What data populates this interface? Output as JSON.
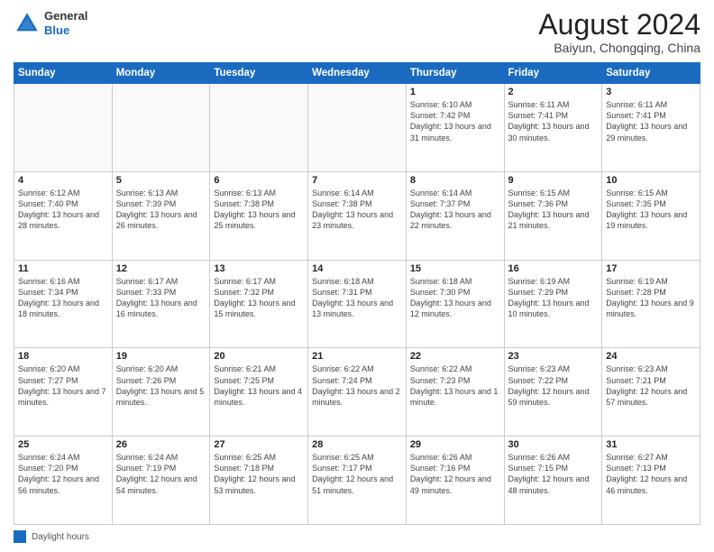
{
  "header": {
    "logo_line1": "General",
    "logo_line2": "Blue",
    "month_title": "August 2024",
    "location": "Baiyun, Chongqing, China"
  },
  "days_of_week": [
    "Sunday",
    "Monday",
    "Tuesday",
    "Wednesday",
    "Thursday",
    "Friday",
    "Saturday"
  ],
  "weeks": [
    [
      {
        "day": "",
        "info": ""
      },
      {
        "day": "",
        "info": ""
      },
      {
        "day": "",
        "info": ""
      },
      {
        "day": "",
        "info": ""
      },
      {
        "day": "1",
        "info": "Sunrise: 6:10 AM\nSunset: 7:42 PM\nDaylight: 13 hours and 31 minutes."
      },
      {
        "day": "2",
        "info": "Sunrise: 6:11 AM\nSunset: 7:41 PM\nDaylight: 13 hours and 30 minutes."
      },
      {
        "day": "3",
        "info": "Sunrise: 6:11 AM\nSunset: 7:41 PM\nDaylight: 13 hours and 29 minutes."
      }
    ],
    [
      {
        "day": "4",
        "info": "Sunrise: 6:12 AM\nSunset: 7:40 PM\nDaylight: 13 hours and 28 minutes."
      },
      {
        "day": "5",
        "info": "Sunrise: 6:13 AM\nSunset: 7:39 PM\nDaylight: 13 hours and 26 minutes."
      },
      {
        "day": "6",
        "info": "Sunrise: 6:13 AM\nSunset: 7:38 PM\nDaylight: 13 hours and 25 minutes."
      },
      {
        "day": "7",
        "info": "Sunrise: 6:14 AM\nSunset: 7:38 PM\nDaylight: 13 hours and 23 minutes."
      },
      {
        "day": "8",
        "info": "Sunrise: 6:14 AM\nSunset: 7:37 PM\nDaylight: 13 hours and 22 minutes."
      },
      {
        "day": "9",
        "info": "Sunrise: 6:15 AM\nSunset: 7:36 PM\nDaylight: 13 hours and 21 minutes."
      },
      {
        "day": "10",
        "info": "Sunrise: 6:15 AM\nSunset: 7:35 PM\nDaylight: 13 hours and 19 minutes."
      }
    ],
    [
      {
        "day": "11",
        "info": "Sunrise: 6:16 AM\nSunset: 7:34 PM\nDaylight: 13 hours and 18 minutes."
      },
      {
        "day": "12",
        "info": "Sunrise: 6:17 AM\nSunset: 7:33 PM\nDaylight: 13 hours and 16 minutes."
      },
      {
        "day": "13",
        "info": "Sunrise: 6:17 AM\nSunset: 7:32 PM\nDaylight: 13 hours and 15 minutes."
      },
      {
        "day": "14",
        "info": "Sunrise: 6:18 AM\nSunset: 7:31 PM\nDaylight: 13 hours and 13 minutes."
      },
      {
        "day": "15",
        "info": "Sunrise: 6:18 AM\nSunset: 7:30 PM\nDaylight: 13 hours and 12 minutes."
      },
      {
        "day": "16",
        "info": "Sunrise: 6:19 AM\nSunset: 7:29 PM\nDaylight: 13 hours and 10 minutes."
      },
      {
        "day": "17",
        "info": "Sunrise: 6:19 AM\nSunset: 7:28 PM\nDaylight: 13 hours and 9 minutes."
      }
    ],
    [
      {
        "day": "18",
        "info": "Sunrise: 6:20 AM\nSunset: 7:27 PM\nDaylight: 13 hours and 7 minutes."
      },
      {
        "day": "19",
        "info": "Sunrise: 6:20 AM\nSunset: 7:26 PM\nDaylight: 13 hours and 5 minutes."
      },
      {
        "day": "20",
        "info": "Sunrise: 6:21 AM\nSunset: 7:25 PM\nDaylight: 13 hours and 4 minutes."
      },
      {
        "day": "21",
        "info": "Sunrise: 6:22 AM\nSunset: 7:24 PM\nDaylight: 13 hours and 2 minutes."
      },
      {
        "day": "22",
        "info": "Sunrise: 6:22 AM\nSunset: 7:23 PM\nDaylight: 13 hours and 1 minute."
      },
      {
        "day": "23",
        "info": "Sunrise: 6:23 AM\nSunset: 7:22 PM\nDaylight: 12 hours and 59 minutes."
      },
      {
        "day": "24",
        "info": "Sunrise: 6:23 AM\nSunset: 7:21 PM\nDaylight: 12 hours and 57 minutes."
      }
    ],
    [
      {
        "day": "25",
        "info": "Sunrise: 6:24 AM\nSunset: 7:20 PM\nDaylight: 12 hours and 56 minutes."
      },
      {
        "day": "26",
        "info": "Sunrise: 6:24 AM\nSunset: 7:19 PM\nDaylight: 12 hours and 54 minutes."
      },
      {
        "day": "27",
        "info": "Sunrise: 6:25 AM\nSunset: 7:18 PM\nDaylight: 12 hours and 53 minutes."
      },
      {
        "day": "28",
        "info": "Sunrise: 6:25 AM\nSunset: 7:17 PM\nDaylight: 12 hours and 51 minutes."
      },
      {
        "day": "29",
        "info": "Sunrise: 6:26 AM\nSunset: 7:16 PM\nDaylight: 12 hours and 49 minutes."
      },
      {
        "day": "30",
        "info": "Sunrise: 6:26 AM\nSunset: 7:15 PM\nDaylight: 12 hours and 48 minutes."
      },
      {
        "day": "31",
        "info": "Sunrise: 6:27 AM\nSunset: 7:13 PM\nDaylight: 12 hours and 46 minutes."
      }
    ]
  ],
  "legend": {
    "label": "Daylight hours"
  }
}
